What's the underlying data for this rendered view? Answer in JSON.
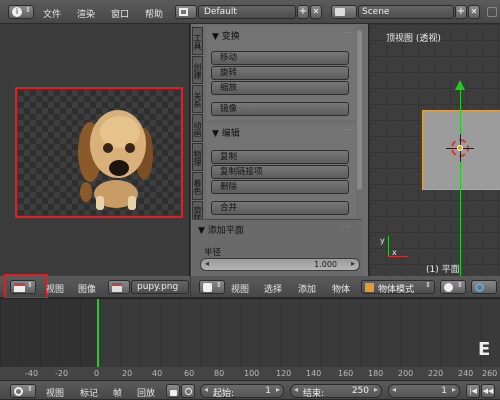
{
  "top_menu": {
    "file": "文件",
    "render": "渲染",
    "window": "窗口",
    "help": "帮助"
  },
  "layout": {
    "value": "Default",
    "add": "+",
    "close": "✕"
  },
  "scene": {
    "value": "Scene",
    "add": "+",
    "close": "✕"
  },
  "tool_tabs": [
    "工具",
    "创建",
    "关系",
    "动画",
    "物理",
    "着色",
    "旋转"
  ],
  "transform_panel": {
    "title": "▼ 变换",
    "buttons": [
      "移动",
      "旋转",
      "缩放",
      "镜像"
    ]
  },
  "edit_panel": {
    "title": "▼ 编辑",
    "buttons": [
      "复制",
      "复制链接项",
      "删除",
      "合并"
    ]
  },
  "add_plane_panel": {
    "title": "▼ 添加平面",
    "radius_label": "半径",
    "radius_value": "1.000"
  },
  "viewport": {
    "title": "顶视图 (透视)",
    "object_label": "(1) 平面",
    "axis_x": "x",
    "axis_y": "y"
  },
  "image_editor_header": {
    "view": "视图",
    "image": "图像",
    "filename": "pupy.png"
  },
  "viewport_header": {
    "view": "视图",
    "select": "选择",
    "add": "添加",
    "object": "物体",
    "mode": "物体模式"
  },
  "timeline": {
    "ticks": [
      "-40",
      "-20",
      "0",
      "20",
      "40",
      "60",
      "80",
      "100",
      "120",
      "140",
      "160",
      "180",
      "200",
      "220",
      "240",
      "260"
    ]
  },
  "timeline_header": {
    "view": "视图",
    "marker": "标记",
    "frame": "帧",
    "playback": "回放",
    "start_label": "起始:",
    "start_value": "1",
    "end_label": "结束:",
    "end_value": "250",
    "current": "1"
  },
  "colors": {
    "highlight_red": "#e02020",
    "selected_orange": "#e8a040",
    "axis_green": "#22cc22",
    "axis_red": "#cc3333"
  }
}
